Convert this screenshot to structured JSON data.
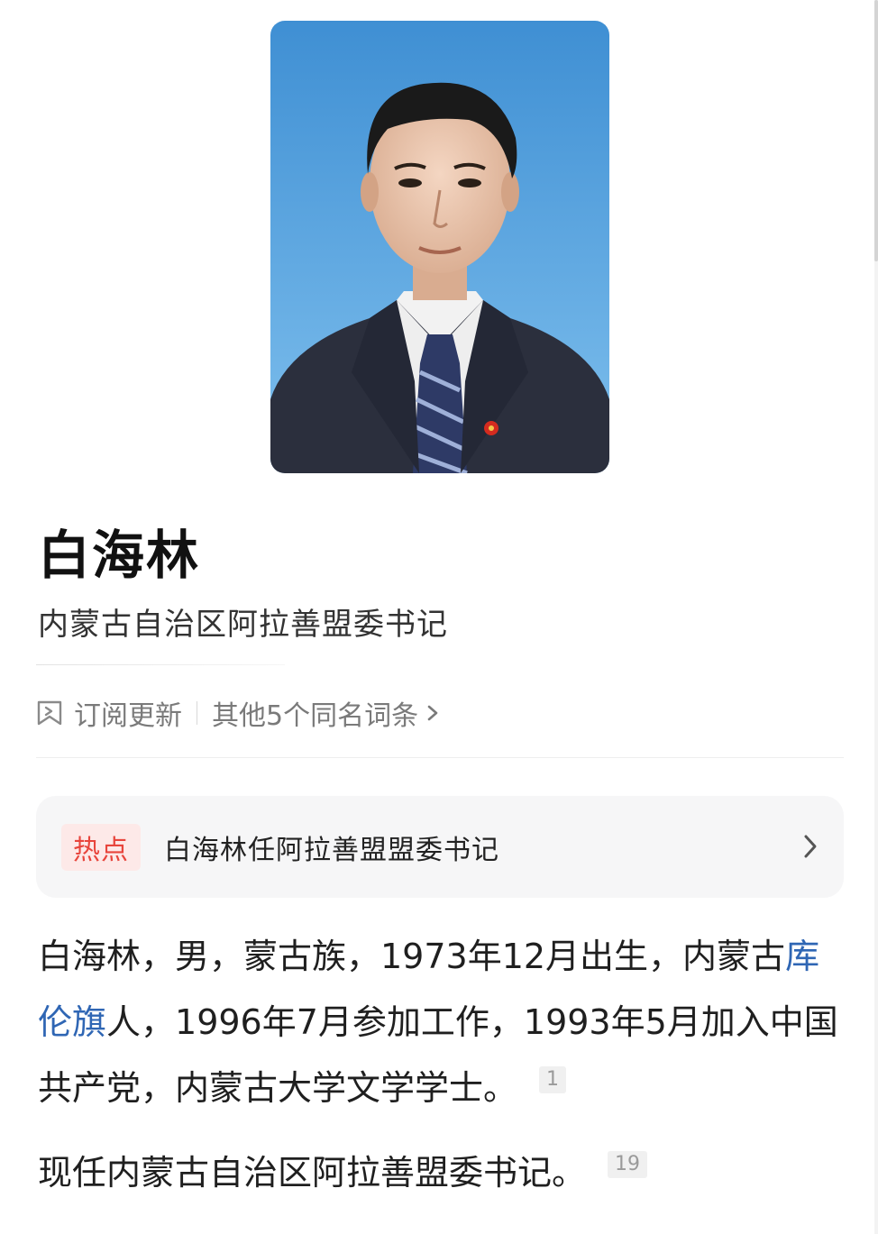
{
  "entry": {
    "name": "白海林",
    "subtitle": "内蒙古自治区阿拉善盟委书记"
  },
  "actions": {
    "subscribe_label": "订阅更新",
    "others_label": "其他5个同名词条"
  },
  "hot": {
    "badge": "热点",
    "text": "白海林任阿拉善盟盟委书记"
  },
  "intro": {
    "part1": "白海林，男，蒙古族，1973年12月出生，内蒙古",
    "link": "库伦旗",
    "part2": "人，1996年7月参加工作，1993年5月加入中国共产党，内蒙古大学文学学士。",
    "ref": "1"
  },
  "current": {
    "text": "现任内蒙古自治区阿拉善盟委书记。",
    "ref": "19"
  },
  "colors": {
    "photo_background": "#4a9ad8",
    "link": "#2f66b4",
    "hot_badge_text": "#e8453c",
    "hot_badge_bg": "#fde9e8"
  }
}
